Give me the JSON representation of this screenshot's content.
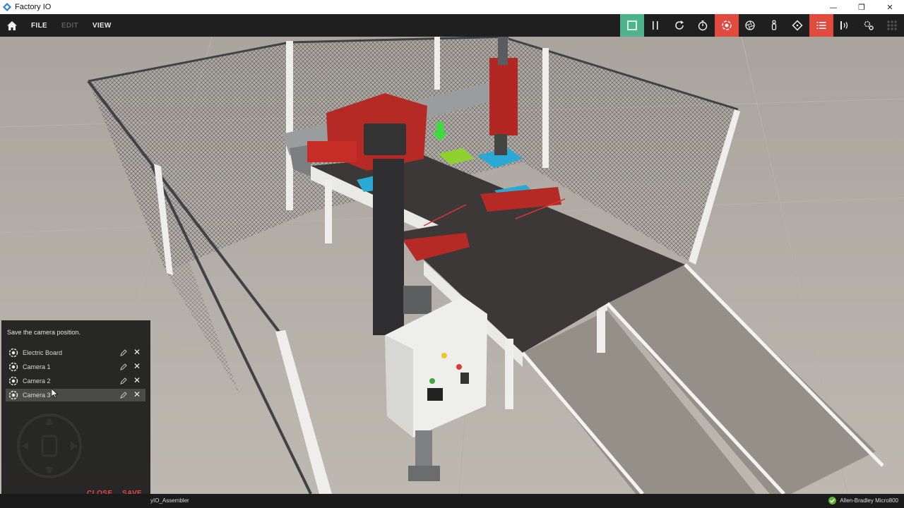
{
  "window": {
    "title": "Factory IO",
    "minimize": "—",
    "restore": "❐",
    "close": "✕"
  },
  "menu": {
    "file": "FILE",
    "edit": "EDIT",
    "view": "VIEW"
  },
  "toolbar": {
    "items": [
      {
        "icon": "stop-icon",
        "active_color": "#4fb48e"
      },
      {
        "icon": "pause-icon"
      },
      {
        "icon": "reset-icon"
      },
      {
        "icon": "timer-icon"
      },
      {
        "icon": "camera-orbit-icon",
        "active_color": "#e04a3f"
      },
      {
        "icon": "aperture-icon"
      },
      {
        "icon": "person-icon"
      },
      {
        "icon": "target-icon"
      },
      {
        "icon": "tag-list-icon",
        "active_color": "#e04a3f"
      },
      {
        "icon": "sensor-icon"
      },
      {
        "icon": "settings-icon"
      },
      {
        "icon": "grid-icon",
        "disabled": true
      }
    ]
  },
  "camera_panel": {
    "hint": "Save the camera position.",
    "cameras": [
      {
        "label": "Electric Board"
      },
      {
        "label": "Camera 1"
      },
      {
        "label": "Camera 2"
      },
      {
        "label": "Camera 3"
      }
    ],
    "close_label": "CLOSE",
    "save_label": "SAVE"
  },
  "status": {
    "scene_name": "yIO_Assembler",
    "driver": "Allen-Bradley Micro800"
  },
  "colors": {
    "accent_red": "#e04a3f",
    "accent_green": "#4fb48e",
    "bar_dark": "#1f1f1f"
  }
}
